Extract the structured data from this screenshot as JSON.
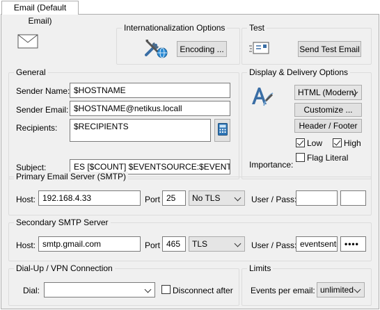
{
  "tab": {
    "label": "Email (Default Email)"
  },
  "i18n": {
    "title": "Internationalization Options",
    "encoding_button": "Encoding ..."
  },
  "test": {
    "title": "Test",
    "send_button": "Send Test Email"
  },
  "general": {
    "title": "General",
    "sender_name_label": "Sender Name:",
    "sender_name_value": "$HOSTNAME",
    "sender_email_label": "Sender Email:",
    "sender_email_value": "$HOSTNAME@netikus.locall",
    "recipients_label": "Recipients:",
    "recipients_value": "$RECIPIENTS",
    "subject_label": "Subject:",
    "subject_value": "ES [$COUNT] $EVENTSOURCE:$EVENTCATEGO"
  },
  "display": {
    "title": "Display & Delivery Options",
    "format_select": "HTML (Modern)",
    "customize_button": "Customize ...",
    "header_footer_button": "Header / Footer",
    "importance_label": "Importance:",
    "low_label": "Low",
    "low_checked": true,
    "high_label": "High",
    "high_checked": true,
    "flag_literal_label": "Flag Literal",
    "flag_literal_checked": false
  },
  "primary_smtp": {
    "title": "Primary Email Server (SMTP)",
    "host_label": "Host:",
    "host_value": "192.168.4.33",
    "port_label": "Port",
    "port_value": "25",
    "tls_select": "No TLS",
    "userpass_label": "User / Pass:",
    "user_value": "",
    "pass_value": ""
  },
  "secondary_smtp": {
    "title": "Secondary SMTP Server",
    "host_label": "Host:",
    "host_value": "smtp.gmail.com",
    "port_label": "Port",
    "port_value": "465",
    "tls_select": "TLS",
    "userpass_label": "User / Pass:",
    "user_value": "eventsentr",
    "pass_value": "••••"
  },
  "dialup": {
    "title": "Dial-Up / VPN Connection",
    "dial_label": "Dial:",
    "dial_value": "",
    "disconnect_label": "Disconnect after"
  },
  "limits": {
    "title": "Limits",
    "events_label": "Events per email:",
    "events_value": "unlimited"
  },
  "colors": {
    "accent": "#0078d7",
    "panel_bg": "#f0f0f0",
    "group_border": "#dcdcdc"
  }
}
